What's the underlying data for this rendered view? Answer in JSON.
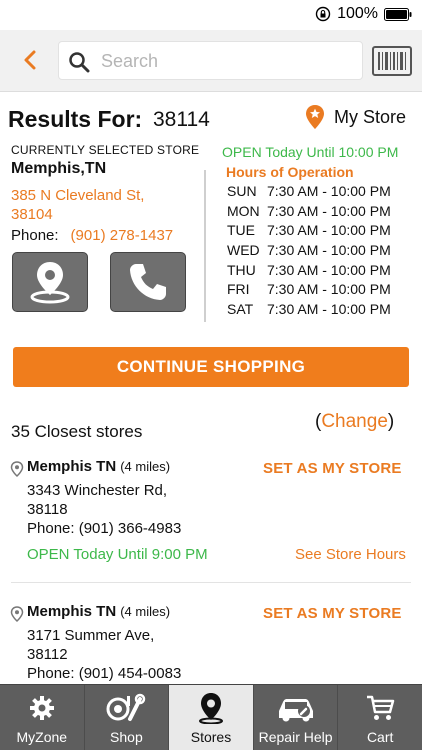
{
  "status_bar": {
    "battery": "100%"
  },
  "search": {
    "placeholder": "Search"
  },
  "results": {
    "title": "Results For:",
    "zip": "38114",
    "my_store_label": "My Store"
  },
  "selected_store": {
    "section_label": "CURRENTLY SELECTED STORE",
    "city": "Memphis,TN",
    "address_line1": "385 N Cleveland St,",
    "address_line2": "38104",
    "phone_label": "Phone:",
    "phone": "(901) 278-1437",
    "open_status": "OPEN Today Until 10:00 PM",
    "hours_title": "Hours of Operation",
    "hours": [
      {
        "day": "SUN",
        "time": "7:30 AM - 10:00 PM"
      },
      {
        "day": "MON",
        "time": "7:30 AM - 10:00 PM"
      },
      {
        "day": "TUE",
        "time": "7:30 AM - 10:00 PM"
      },
      {
        "day": "WED",
        "time": "7:30 AM - 10:00 PM"
      },
      {
        "day": "THU",
        "time": "7:30 AM - 10:00 PM"
      },
      {
        "day": "FRI",
        "time": "7:30 AM - 10:00 PM"
      },
      {
        "day": "SAT",
        "time": "7:30 AM - 10:00 PM"
      }
    ]
  },
  "continue_button": "CONTINUE SHOPPING",
  "closest": {
    "count_label": "35 Closest stores",
    "open_paren": "(",
    "change_label": "Change",
    "close_paren": ")"
  },
  "stores": [
    {
      "name": "Memphis TN",
      "distance": "(4 miles)",
      "set_label": "SET AS MY STORE",
      "address_line1": "3343 Winchester Rd,",
      "address_line2": "38118",
      "phone": "Phone: (901) 366-4983",
      "open_status": "OPEN Today Until 9:00 PM",
      "see_hours": "See Store Hours"
    },
    {
      "name": "Memphis TN",
      "distance": "(4 miles)",
      "set_label": "SET AS MY STORE",
      "address_line1": "3171 Summer Ave,",
      "address_line2": "38112",
      "phone": "Phone: (901) 454-0083"
    }
  ],
  "tabs": [
    {
      "label": "MyZone",
      "icon": "gear-icon",
      "active": false
    },
    {
      "label": "Shop",
      "icon": "parts-icon",
      "active": false
    },
    {
      "label": "Stores",
      "icon": "location-pin-icon",
      "active": true
    },
    {
      "label": "Repair Help",
      "icon": "car-wrench-icon",
      "active": false
    },
    {
      "label": "Cart",
      "icon": "cart-icon",
      "active": false
    }
  ],
  "colors": {
    "accent": "#ea7b22",
    "button": "#f07d1c",
    "open_green": "#3db84a",
    "tabbar": "#5e5e5e"
  }
}
